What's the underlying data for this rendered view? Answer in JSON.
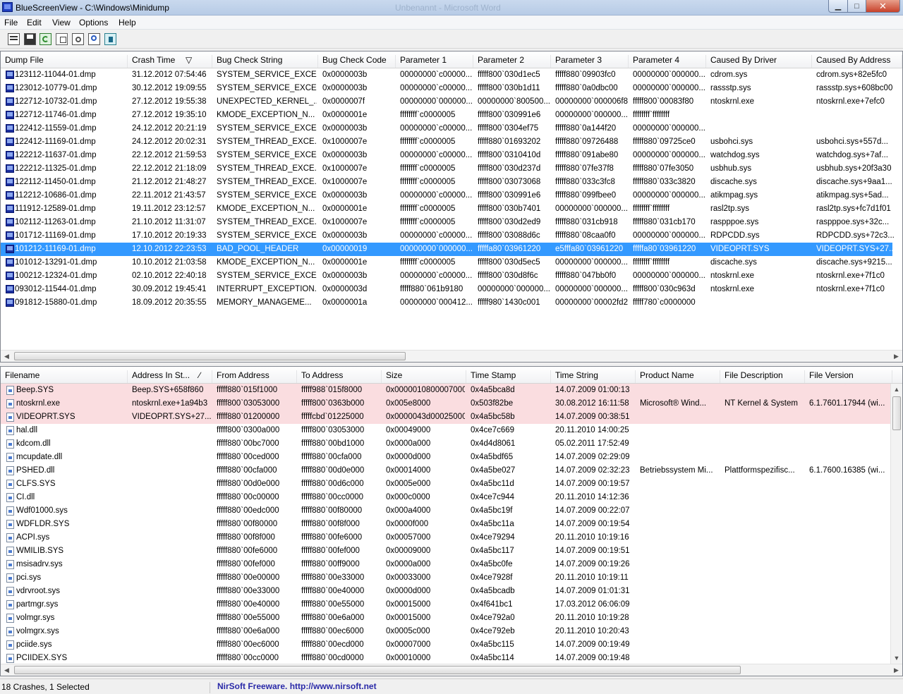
{
  "window": {
    "title": "BlueScreenView  -  C:\\Windows\\Minidump",
    "ghost_title": "Unbenannt - Microsoft Word"
  },
  "window_buttons": {
    "minimize": "▁",
    "maximize": "□",
    "close": "✕"
  },
  "menu": [
    "File",
    "Edit",
    "View",
    "Options",
    "Help"
  ],
  "toolbar": [
    "properties-icon",
    "save-icon",
    "refresh-icon",
    "copy-icon",
    "options-icon",
    "find-icon",
    "exit-icon"
  ],
  "crash_columns": [
    "Dump File",
    "Crash Time",
    "Bug Check String",
    "Bug Check Code",
    "Parameter 1",
    "Parameter 2",
    "Parameter 3",
    "Parameter 4",
    "Caused By Driver",
    "Caused By Address"
  ],
  "crashes": [
    [
      "123112-11044-01.dmp",
      "31.12.2012 07:54:46",
      "SYSTEM_SERVICE_EXCE...",
      "0x0000003b",
      "00000000`c00000...",
      "fffff800`030d1ec5",
      "fffff880`09903fc0",
      "00000000`000000...",
      "cdrom.sys",
      "cdrom.sys+82e5fc0"
    ],
    [
      "123012-10779-01.dmp",
      "30.12.2012 19:09:55",
      "SYSTEM_SERVICE_EXCE...",
      "0x0000003b",
      "00000000`c00000...",
      "fffff800`030b1d11",
      "fffff880`0a0dbc00",
      "00000000`000000...",
      "rassstp.sys",
      "rassstp.sys+608bc00"
    ],
    [
      "122712-10732-01.dmp",
      "27.12.2012 19:55:38",
      "UNEXPECTED_KERNEL_...",
      "0x0000007f",
      "00000000`000000...",
      "00000000`800500...",
      "00000000`000006f8",
      "fffff800`00083f80",
      "ntoskrnl.exe",
      "ntoskrnl.exe+7efc0"
    ],
    [
      "122712-11746-01.dmp",
      "27.12.2012 19:35:10",
      "KMODE_EXCEPTION_N...",
      "0x0000001e",
      "ffffffff`c0000005",
      "fffff800`030991e6",
      "00000000`000000...",
      "ffffffff`ffffffff",
      "",
      ""
    ],
    [
      "122412-11559-01.dmp",
      "24.12.2012 20:21:19",
      "SYSTEM_SERVICE_EXCE...",
      "0x0000003b",
      "00000000`c00000...",
      "fffff800`0304ef75",
      "fffff880`0a144f20",
      "00000000`000000...",
      "",
      ""
    ],
    [
      "122412-11169-01.dmp",
      "24.12.2012 20:02:31",
      "SYSTEM_THREAD_EXCE...",
      "0x1000007e",
      "ffffffff`c0000005",
      "fffff880`01693202",
      "fffff880`09726488",
      "fffff880`09725ce0",
      "usbohci.sys",
      "usbohci.sys+557d..."
    ],
    [
      "122212-11637-01.dmp",
      "22.12.2012 21:59:53",
      "SYSTEM_SERVICE_EXCE...",
      "0x0000003b",
      "00000000`c00000...",
      "fffff800`0310410d",
      "fffff880`091abe80",
      "00000000`000000...",
      "watchdog.sys",
      "watchdog.sys+7af..."
    ],
    [
      "122212-11325-01.dmp",
      "22.12.2012 21:18:09",
      "SYSTEM_THREAD_EXCE...",
      "0x1000007e",
      "ffffffff`c0000005",
      "fffff800`030d237d",
      "fffff880`07fe37f8",
      "fffff880`07fe3050",
      "usbhub.sys",
      "usbhub.sys+20f3a30"
    ],
    [
      "122112-11450-01.dmp",
      "21.12.2012 21:48:27",
      "SYSTEM_THREAD_EXCE...",
      "0x1000007e",
      "ffffffff`c0000005",
      "fffff800`03073068",
      "fffff880`033c3fc8",
      "fffff880`033c3820",
      "discache.sys",
      "discache.sys+9aa1..."
    ],
    [
      "112212-10686-01.dmp",
      "22.11.2012 21:43:57",
      "SYSTEM_SERVICE_EXCE...",
      "0x0000003b",
      "00000000`c00000...",
      "fffff800`030991e6",
      "fffff880`099fbee0",
      "00000000`000000...",
      "atikmpag.sys",
      "atikmpag.sys+5ad..."
    ],
    [
      "111912-12589-01.dmp",
      "19.11.2012 23:12:57",
      "KMODE_EXCEPTION_N...",
      "0x0000001e",
      "ffffffff`c0000005",
      "fffff800`030b7401",
      "00000000`000000...",
      "ffffffff`ffffffff",
      "rasl2tp.sys",
      "rasl2tp.sys+fc7d1f01"
    ],
    [
      "102112-11263-01.dmp",
      "21.10.2012 11:31:07",
      "SYSTEM_THREAD_EXCE...",
      "0x1000007e",
      "ffffffff`c0000005",
      "fffff800`030d2ed9",
      "fffff880`031cb918",
      "fffff880`031cb170",
      "raspppoe.sys",
      "raspppoe.sys+32c..."
    ],
    [
      "101712-11169-01.dmp",
      "17.10.2012 20:19:33",
      "SYSTEM_SERVICE_EXCE...",
      "0x0000003b",
      "00000000`c00000...",
      "fffff800`03088d6c",
      "fffff880`08caa0f0",
      "00000000`000000...",
      "RDPCDD.sys",
      "RDPCDD.sys+72c3..."
    ],
    [
      "101212-11169-01.dmp",
      "12.10.2012 22:23:53",
      "BAD_POOL_HEADER",
      "0x00000019",
      "00000000`000000...",
      "fffffa80`03961220",
      "e5fffa80`03961220",
      "fffffa80`03961220",
      "VIDEOPRT.SYS",
      "VIDEOPRT.SYS+27..."
    ],
    [
      "101012-13291-01.dmp",
      "10.10.2012 21:03:58",
      "KMODE_EXCEPTION_N...",
      "0x0000001e",
      "ffffffff`c0000005",
      "fffff800`030d5ec5",
      "00000000`000000...",
      "ffffffff`ffffffff",
      "discache.sys",
      "discache.sys+9215..."
    ],
    [
      "100212-12324-01.dmp",
      "02.10.2012 22:40:18",
      "SYSTEM_SERVICE_EXCE...",
      "0x0000003b",
      "00000000`c00000...",
      "fffff800`030d8f6c",
      "fffff880`047bb0f0",
      "00000000`000000...",
      "ntoskrnl.exe",
      "ntoskrnl.exe+7f1c0"
    ],
    [
      "093012-11544-01.dmp",
      "30.09.2012 19:45:41",
      "INTERRUPT_EXCEPTION...",
      "0x0000003d",
      "fffff880`061b9180",
      "00000000`000000...",
      "00000000`000000...",
      "fffff800`030c963d",
      "ntoskrnl.exe",
      "ntoskrnl.exe+7f1c0"
    ],
    [
      "091812-15880-01.dmp",
      "18.09.2012 20:35:55",
      "MEMORY_MANAGEME...",
      "0x0000001a",
      "00000000`000412...",
      "fffff980`1430c001",
      "00000000`00002fd2",
      "fffff780`c0000000",
      "",
      ""
    ]
  ],
  "selected_crash_index": 13,
  "driver_columns": [
    "Filename",
    "Address In St...",
    "From Address",
    "To Address",
    "Size",
    "Time Stamp",
    "Time String",
    "Product Name",
    "File Description",
    "File Version"
  ],
  "drivers": [
    [
      "Beep.SYS",
      "Beep.SYS+658f860",
      "fffff880`015f1000",
      "fffff988`015f8000",
      "0x0000010800007000",
      "0x4a5bca8d",
      "14.07.2009 01:00:13",
      "",
      "",
      ""
    ],
    [
      "ntoskrnl.exe",
      "ntoskrnl.exe+1a94b3",
      "fffff800`03053000",
      "fffff800`0363b000",
      "0x005e8000",
      "0x503f82be",
      "30.08.2012 16:11:58",
      "Microsoft® Wind...",
      "NT Kernel & System",
      "6.1.7601.17944 (wi..."
    ],
    [
      "VIDEOPRT.SYS",
      "VIDEOPRT.SYS+27...",
      "fffff880`01200000",
      "fffffcbd`01225000",
      "0x0000043d00025000",
      "0x4a5bc58b",
      "14.07.2009 00:38:51",
      "",
      "",
      ""
    ],
    [
      "hal.dll",
      "",
      "fffff800`0300a000",
      "fffff800`03053000",
      "0x00049000",
      "0x4ce7c669",
      "20.11.2010 14:00:25",
      "",
      "",
      ""
    ],
    [
      "kdcom.dll",
      "",
      "fffff880`00bc7000",
      "fffff880`00bd1000",
      "0x0000a000",
      "0x4d4d8061",
      "05.02.2011 17:52:49",
      "",
      "",
      ""
    ],
    [
      "mcupdate.dll",
      "",
      "fffff880`00ced000",
      "fffff880`00cfa000",
      "0x0000d000",
      "0x4a5bdf65",
      "14.07.2009 02:29:09",
      "",
      "",
      ""
    ],
    [
      "PSHED.dll",
      "",
      "fffff880`00cfa000",
      "fffff880`00d0e000",
      "0x00014000",
      "0x4a5be027",
      "14.07.2009 02:32:23",
      "Betriebssystem Mi...",
      "Plattformspezifisc...",
      "6.1.7600.16385 (wi..."
    ],
    [
      "CLFS.SYS",
      "",
      "fffff880`00d0e000",
      "fffff880`00d6c000",
      "0x0005e000",
      "0x4a5bc11d",
      "14.07.2009 00:19:57",
      "",
      "",
      ""
    ],
    [
      "CI.dll",
      "",
      "fffff880`00c00000",
      "fffff880`00cc0000",
      "0x000c0000",
      "0x4ce7c944",
      "20.11.2010 14:12:36",
      "",
      "",
      ""
    ],
    [
      "Wdf01000.sys",
      "",
      "fffff880`00edc000",
      "fffff880`00f80000",
      "0x000a4000",
      "0x4a5bc19f",
      "14.07.2009 00:22:07",
      "",
      "",
      ""
    ],
    [
      "WDFLDR.SYS",
      "",
      "fffff880`00f80000",
      "fffff880`00f8f000",
      "0x0000f000",
      "0x4a5bc11a",
      "14.07.2009 00:19:54",
      "",
      "",
      ""
    ],
    [
      "ACPI.sys",
      "",
      "fffff880`00f8f000",
      "fffff880`00fe6000",
      "0x00057000",
      "0x4ce79294",
      "20.11.2010 10:19:16",
      "",
      "",
      ""
    ],
    [
      "WMILIB.SYS",
      "",
      "fffff880`00fe6000",
      "fffff880`00fef000",
      "0x00009000",
      "0x4a5bc117",
      "14.07.2009 00:19:51",
      "",
      "",
      ""
    ],
    [
      "msisadrv.sys",
      "",
      "fffff880`00fef000",
      "fffff880`00ff9000",
      "0x0000a000",
      "0x4a5bc0fe",
      "14.07.2009 00:19:26",
      "",
      "",
      ""
    ],
    [
      "pci.sys",
      "",
      "fffff880`00e00000",
      "fffff880`00e33000",
      "0x00033000",
      "0x4ce7928f",
      "20.11.2010 10:19:11",
      "",
      "",
      ""
    ],
    [
      "vdrvroot.sys",
      "",
      "fffff880`00e33000",
      "fffff880`00e40000",
      "0x0000d000",
      "0x4a5bcadb",
      "14.07.2009 01:01:31",
      "",
      "",
      ""
    ],
    [
      "partmgr.sys",
      "",
      "fffff880`00e40000",
      "fffff880`00e55000",
      "0x00015000",
      "0x4f641bc1",
      "17.03.2012 06:06:09",
      "",
      "",
      ""
    ],
    [
      "volmgr.sys",
      "",
      "fffff880`00e55000",
      "fffff880`00e6a000",
      "0x00015000",
      "0x4ce792a0",
      "20.11.2010 10:19:28",
      "",
      "",
      ""
    ],
    [
      "volmgrx.sys",
      "",
      "fffff880`00e6a000",
      "fffff880`00ec6000",
      "0x0005c000",
      "0x4ce792eb",
      "20.11.2010 10:20:43",
      "",
      "",
      ""
    ],
    [
      "pciide.sys",
      "",
      "fffff880`00ec6000",
      "fffff880`00ecd000",
      "0x00007000",
      "0x4a5bc115",
      "14.07.2009 00:19:49",
      "",
      "",
      ""
    ],
    [
      "PCIIDEX.SYS",
      "",
      "fffff880`00cc0000",
      "fffff880`00cd0000",
      "0x00010000",
      "0x4a5bc114",
      "14.07.2009 00:19:48",
      "",
      "",
      ""
    ]
  ],
  "highlighted_driver_count": 3,
  "status": {
    "count": "18 Crashes, 1 Selected",
    "credit": "NirSoft Freeware.  http://www.nirsoft.net"
  }
}
